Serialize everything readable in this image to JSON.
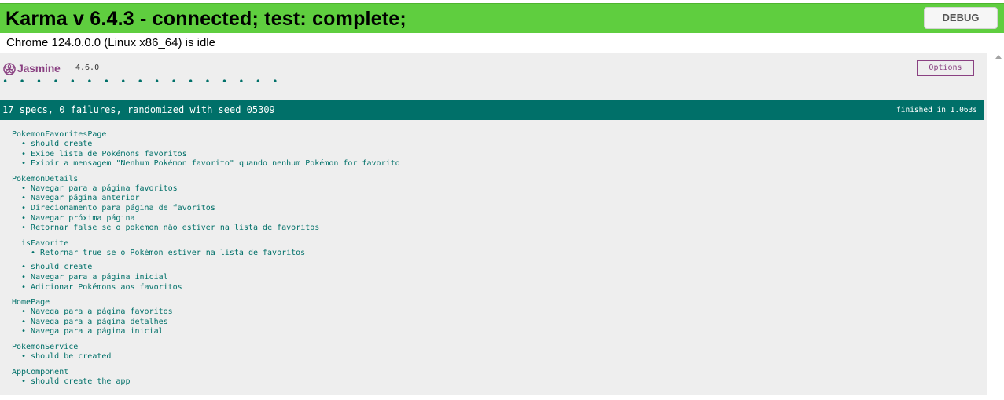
{
  "karma": {
    "title": "Karma v 6.4.3 - connected; test: complete;",
    "debug_label": "DEBUG",
    "browser_status": "Chrome 124.0.0.0 (Linux x86_64) is idle"
  },
  "jasmine": {
    "name": "Jasmine",
    "version": "4.6.0",
    "options_label": "Options",
    "dots": "• • • • • • • • • • • • • • • • •",
    "passed_count": 17
  },
  "summary": {
    "text": "17 specs, 0 failures, randomized with seed 05309",
    "duration": "finished in 1.063s"
  },
  "colors": {
    "karma_banner": "#5fce3f",
    "jasmine_green": "#007069",
    "jasmine_purple": "#8a4182",
    "background": "#eeeeee"
  },
  "suites": [
    {
      "name": "PokemonFavoritesPage",
      "specs": [
        "should create",
        "Exibe lista de Pokémons favoritos",
        "Exibir a mensagem \"Nenhum Pokémon favorito\" quando nenhum Pokémon for favorito"
      ]
    },
    {
      "name": "PokemonDetails",
      "specs": [
        "Navegar para a página favoritos",
        "Navegar página anterior",
        "Direcionamento para página de favoritos",
        "Navegar próxima página",
        "Retornar false se o pokémon não estiver na lista de favoritos"
      ],
      "nested": {
        "name": "isFavorite",
        "specs": [
          "Retornar true se o Pokémon estiver na lista de favoritos"
        ]
      },
      "specs_after": [
        "should create",
        "Navegar para a página inicial",
        "Adicionar Pokémons aos favoritos"
      ]
    },
    {
      "name": "HomePage",
      "specs": [
        "Navega para a página favoritos",
        "Navega para a página detalhes",
        "Navega para a página inicial"
      ]
    },
    {
      "name": "PokemonService",
      "specs": [
        "should be created"
      ]
    },
    {
      "name": "AppComponent",
      "specs": [
        "should create the app"
      ]
    }
  ]
}
